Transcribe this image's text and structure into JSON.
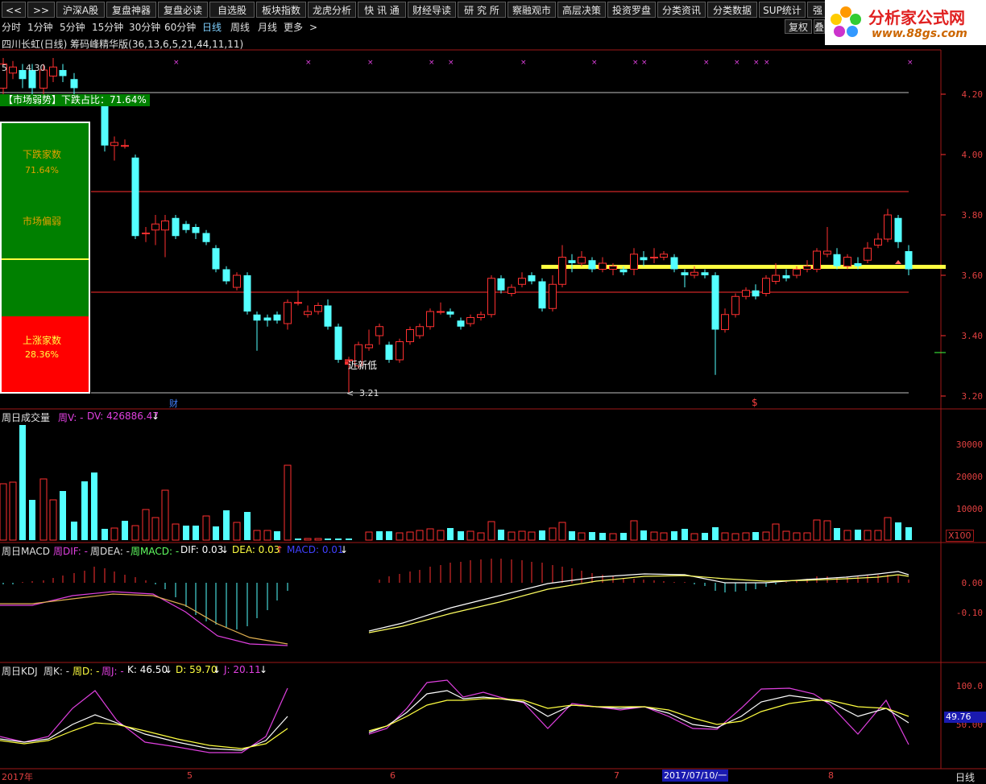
{
  "menu": {
    "nav_prev": "<<",
    "nav_next": ">>",
    "items": [
      "沪深A股",
      "复盘神器",
      "复盘必读",
      "自选股",
      "板块指数",
      "龙虎分析",
      "快 讯 通",
      "财经导读",
      "研 究 所",
      "察融观市",
      "高层决策",
      "投资罗盘",
      "分类资讯",
      "分类数据",
      "SUP统计",
      "强"
    ]
  },
  "periods": [
    "分时",
    "1分钟",
    "5分钟",
    "15分钟",
    "30分钟",
    "60分钟",
    "日线",
    "周线",
    "月线",
    "更多"
  ],
  "active_period": "日线",
  "more_arrow": ">",
  "right_buttons": [
    "复权",
    "叠"
  ],
  "logo": {
    "text": "分析家公式网",
    "url_text": "www.88gs.com"
  },
  "title": "四川长虹(日线) 筹码峰精华版(36,13,6,5,21,44,11,11)",
  "price_pane": {
    "top_label": "4.30",
    "top_prefix": "5",
    "market_tag": "【市场弱势】下跌占比：71.64%",
    "panel": {
      "down_label": "下跌家数",
      "down_pct": "71.64%",
      "bias_label": "市场偏弱",
      "up_label": "上涨家数",
      "up_pct": "28.36%"
    },
    "new_low_label": "近新低",
    "low_value": "3.21",
    "low_arrow": "<",
    "cai_mark": "财",
    "dollar_mark": "$",
    "axis": [
      "4.20",
      "4.00",
      "3.80",
      "3.60",
      "3.40",
      "3.20"
    ]
  },
  "volume_pane": {
    "title": "周日成交量",
    "wv": "周V: -",
    "dv": "DV: 426886.47",
    "arrow": "↓",
    "axis": [
      "30000",
      "20000",
      "10000"
    ],
    "unit": "X100"
  },
  "macd_pane": {
    "title": "周日MACD",
    "dif_w": "周DIF: -",
    "dea_w": "周DEA: -",
    "macd_w": "周MACD: -",
    "dif": "DIF: 0.03",
    "dif_arrow": "↓",
    "dea": "DEA: 0.03",
    "dea_arrow": "↑",
    "macd": "MACD: 0.01",
    "macd_arrow": "↓",
    "axis": [
      "0.00",
      "-0.10"
    ]
  },
  "kdj_pane": {
    "title": "周日KDJ",
    "k_w": "周K: -",
    "d_w": "周D: -",
    "j_w": "周J: -",
    "k": "K: 46.50",
    "k_arrow": "↓",
    "d": "D: 59.70",
    "d_arrow": "↓",
    "j": "J: 20.11",
    "j_arrow": "↓",
    "axis": [
      "100.0",
      "50.00"
    ],
    "current": "49.76"
  },
  "time_axis": {
    "labels": [
      "2017年",
      "5",
      "6",
      "7",
      "8"
    ],
    "cursor_date": "2017/07/10/一",
    "period_label": "日线"
  },
  "colors": {
    "up": "#ff3030",
    "down": "#54ffff",
    "accent_yellow": "#ffff40",
    "magenta": "#e040e0",
    "panel_green": "#008000",
    "panel_red": "#ff0000",
    "tag_green": "#008000"
  }
}
